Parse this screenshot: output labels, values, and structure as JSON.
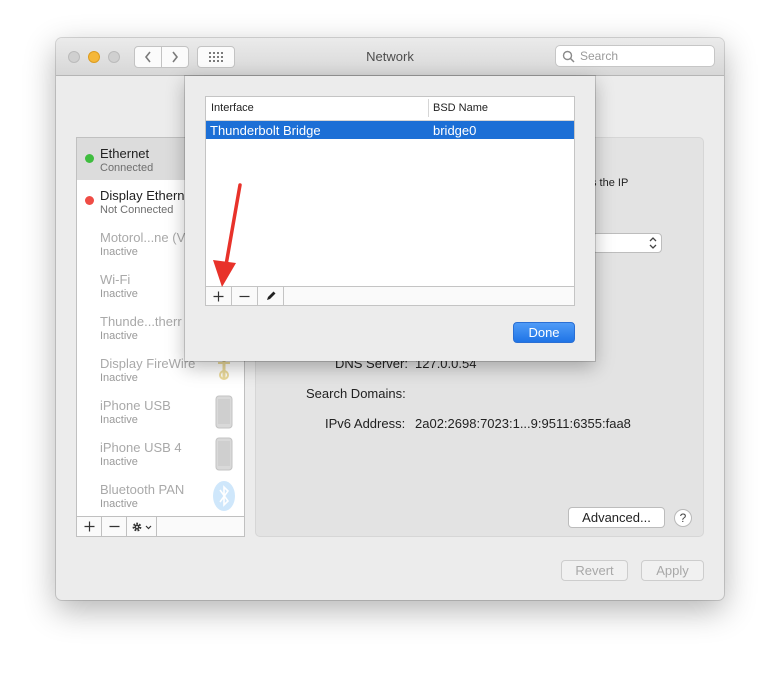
{
  "window": {
    "title": "Network",
    "search_placeholder": "Search"
  },
  "services": [
    {
      "name": "Ethernet",
      "status": "Connected",
      "state": "connected",
      "dot_color": "#3fbd3f",
      "selected": true
    },
    {
      "name": "Display Ethern",
      "status": "Not Connected",
      "state": "disconnected",
      "dot_color": "#ef4c45"
    },
    {
      "name": "Motorol...ne (V",
      "status": "Inactive",
      "state": "inactive"
    },
    {
      "name": "Wi-Fi",
      "status": "Inactive",
      "state": "inactive"
    },
    {
      "name": "Thunde...therr",
      "status": "Inactive",
      "state": "inactive"
    },
    {
      "name": "Display FireWire",
      "status": "Inactive",
      "state": "inactive",
      "icon": "firewire-icon"
    },
    {
      "name": "iPhone USB",
      "status": "Inactive",
      "state": "inactive",
      "icon": "iphone-icon"
    },
    {
      "name": "iPhone USB 4",
      "status": "Inactive",
      "state": "inactive",
      "icon": "iphone-icon"
    },
    {
      "name": "Bluetooth PAN",
      "status": "Inactive",
      "state": "inactive",
      "icon": "bluetooth-icon"
    }
  ],
  "detail": {
    "ip_fragment": "s the IP",
    "dns_label": "DNS Server:",
    "dns_value": "127.0.0.54",
    "search_domains_label": "Search Domains:",
    "ipv6_label": "IPv6 Address:",
    "ipv6_value": "2a02:2698:7023:1...9:9511:6355:faa8",
    "advanced_label": "Advanced...",
    "help_label": "?"
  },
  "footer": {
    "revert_label": "Revert",
    "apply_label": "Apply"
  },
  "sheet": {
    "columns": [
      "Interface",
      "BSD Name"
    ],
    "rows": [
      {
        "interface": "Thunderbolt Bridge",
        "bsd_name": "bridge0"
      }
    ],
    "done_label": "Done"
  },
  "colors": {
    "accent": "#1c6fd6",
    "annotation_arrow": "#e8322a"
  }
}
